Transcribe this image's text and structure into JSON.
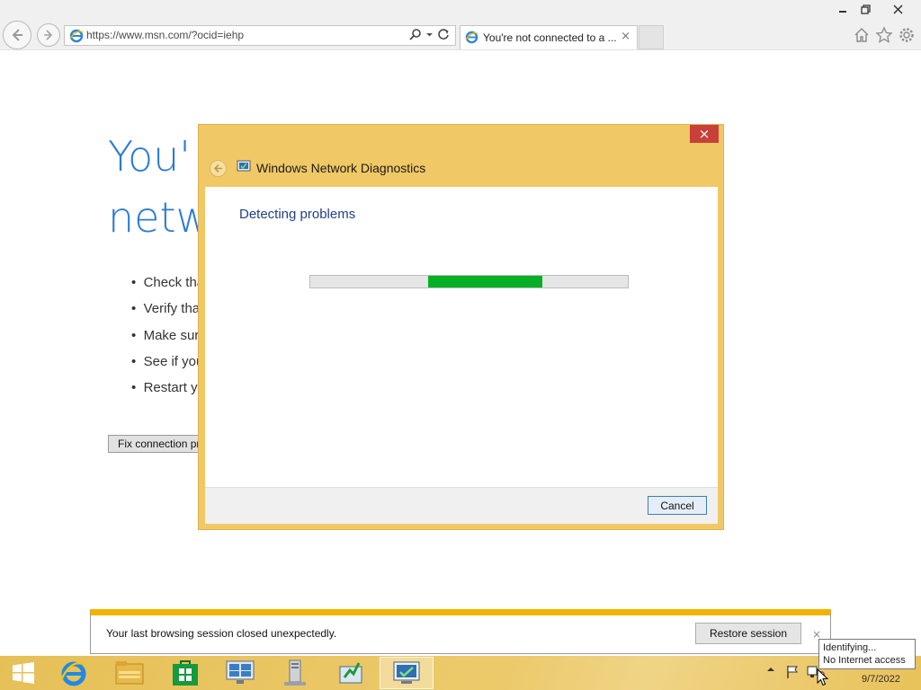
{
  "browser": {
    "address": "https://www.msn.com/?ocid=iehp",
    "tab_title": "You're not connected to a ...",
    "tab_close": "×"
  },
  "page": {
    "title_line1": "You'",
    "title_line2": "netw",
    "bullets": [
      "Check tha",
      "Verify tha",
      "Make sur",
      "See if you",
      "Restart yo"
    ],
    "fix_button": "Fix connection pr"
  },
  "dialog": {
    "title": "Windows Network Diagnostics",
    "heading": "Detecting problems",
    "close": "×",
    "cancel": "Cancel",
    "progress_fill": {
      "start": 0.37,
      "end": 0.73
    },
    "progress_color": "#06b025",
    "frame_color": "#f0c865"
  },
  "notification": {
    "message": "Your last browsing session closed unexpectedly.",
    "restore": "Restore session",
    "close": "×"
  },
  "taskbar": {
    "items": [
      "start-icon",
      "internet-explorer-icon",
      "file-explorer-icon",
      "store-icon",
      "remote-desktop-icon",
      "server-manager-icon",
      "network-setup-icon",
      "network-diagnostics-icon"
    ],
    "clock_date": "9/7/2022"
  },
  "tooltip": {
    "line1": "Identifying...",
    "line2": "No Internet access"
  }
}
